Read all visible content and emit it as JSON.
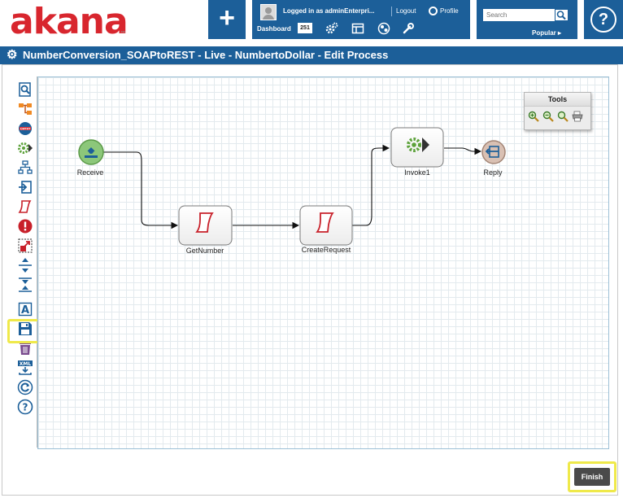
{
  "brand": {
    "logo_text": "akana",
    "tm": "™"
  },
  "header": {
    "add_label": "+",
    "user": {
      "logged_in_text": "Logged in as adminEnterpri...",
      "logout_label": "Logout",
      "profile_label": "Profile"
    },
    "dashboard_label": "Dashboard",
    "dashboard_count": "251",
    "search": {
      "placeholder": "Search",
      "popular_label": "Popular ▸"
    },
    "help_label": "?"
  },
  "titlebar": {
    "title": "NumberConversion_SOAPtoREST - Live - NumbertoDollar - Edit Process"
  },
  "toolbar": {
    "items": [
      "Find",
      "Flow",
      "Context",
      "Invoke",
      "Hierarchy",
      "Import",
      "Script",
      "Error",
      "Resize",
      "Expand",
      "Collapse",
      "Text",
      "Save",
      "Delete",
      "XML Export",
      "Refresh",
      "Help"
    ]
  },
  "tools_panel": {
    "title": "Tools"
  },
  "process": {
    "nodes": [
      {
        "id": "receive",
        "label": "Receive"
      },
      {
        "id": "getnumber",
        "label": "GetNumber"
      },
      {
        "id": "createrequest",
        "label": "CreateRequest"
      },
      {
        "id": "invoke1",
        "label": "Invoke1"
      },
      {
        "id": "reply",
        "label": "Reply"
      }
    ]
  },
  "footer": {
    "finish_label": "Finish"
  },
  "colors": {
    "brand_blue": "#1c5f99",
    "logo_red": "#d8262e",
    "highlight_yellow": "#efe94a",
    "script_red": "#c8202a",
    "gear_green": "#5ca23a"
  }
}
